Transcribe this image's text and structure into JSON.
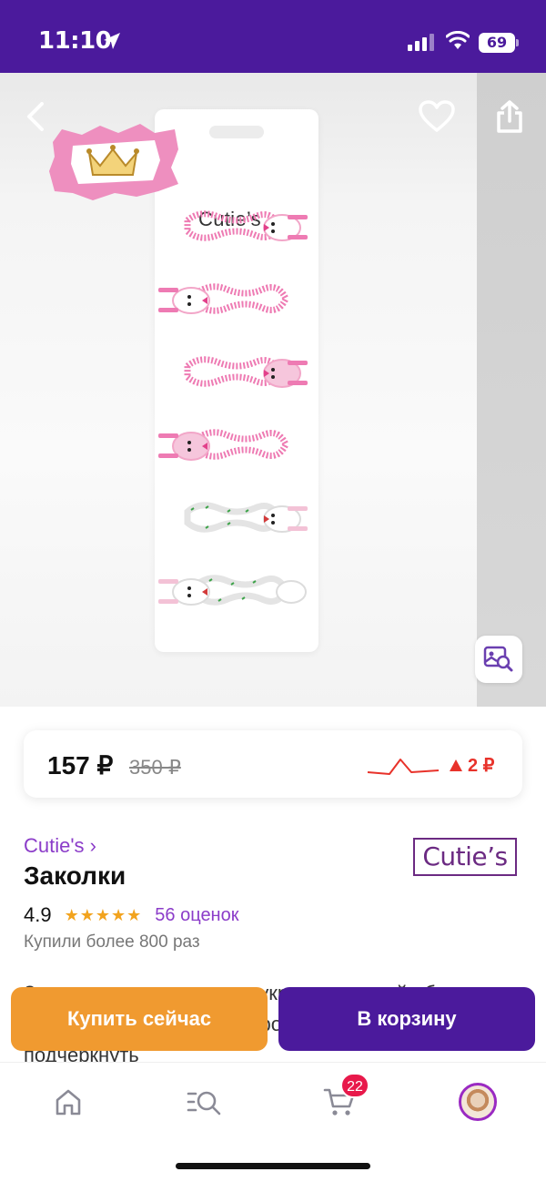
{
  "status_bar": {
    "time": "11:10",
    "battery": "69"
  },
  "gallery": {
    "card_logo": "Cutie’s",
    "back_icon": "chevron-left-icon",
    "favorite_icon": "heart-icon",
    "share_icon": "share-icon",
    "image_search_icon": "image-search-icon"
  },
  "price": {
    "current": "157 ₽",
    "old": "350 ₽",
    "change": "2 ₽",
    "change_color": "#e8322a"
  },
  "product": {
    "brand_link": "Cutie's ›",
    "brand_logo": "Cutie’s",
    "title": "Заколки",
    "rating": "4.9",
    "stars": "★★★★★",
    "reviews": "56 оценок",
    "bought": "Купили более 800 раз",
    "description": "Заколки-невидимки ярко украсят детский образ, а также помогут создать хорошее настроение и подчеркнуть"
  },
  "actions": {
    "buy_now": "Купить сейчас",
    "add_to_cart": "В корзину"
  },
  "tabbar": {
    "cart_badge": "22"
  },
  "colors": {
    "brand_purple": "#4b1a9c",
    "accent_orange": "#f09a30",
    "link_purple": "#8b3cc9",
    "star": "#f2a31e"
  }
}
